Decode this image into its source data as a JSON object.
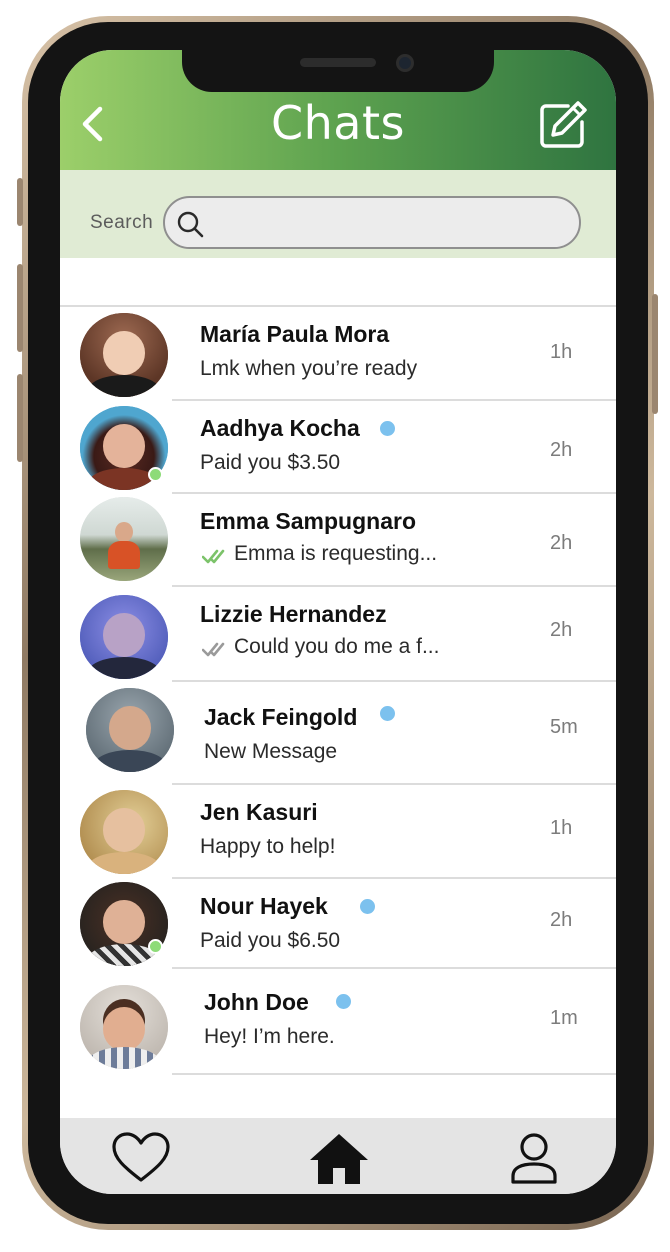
{
  "header": {
    "title": "Chats",
    "back_icon": "chevron-left-icon",
    "compose_icon": "compose-icon"
  },
  "search": {
    "label": "Search",
    "value": "",
    "icon": "search-icon"
  },
  "chats": [
    {
      "name": "María Paula Mora",
      "preview": "Lmk when you’re ready",
      "time": "1h",
      "unread": false,
      "online": false,
      "receipt": "none"
    },
    {
      "name": "Aadhya Kocha",
      "preview": "Paid you $3.50",
      "time": "2h",
      "unread": true,
      "online": true,
      "receipt": "none"
    },
    {
      "name": "Emma Sampugnaro",
      "preview": "Emma is requesting...",
      "time": "2h",
      "unread": false,
      "online": false,
      "receipt": "read"
    },
    {
      "name": "Lizzie Hernandez",
      "preview": "Could you do me a f...",
      "time": "2h",
      "unread": false,
      "online": false,
      "receipt": "delivered"
    },
    {
      "name": "Jack Feingold",
      "preview": "New Message",
      "time": "5m",
      "unread": true,
      "online": false,
      "receipt": "none"
    },
    {
      "name": "Jen Kasuri",
      "preview": "Happy to help!",
      "time": "1h",
      "unread": false,
      "online": false,
      "receipt": "none"
    },
    {
      "name": "Nour Hayek",
      "preview": "Paid you $6.50",
      "time": "2h",
      "unread": true,
      "online": true,
      "receipt": "none"
    },
    {
      "name": "John Doe",
      "preview": "Hey! I’m here.",
      "time": "1m",
      "unread": true,
      "online": false,
      "receipt": "none"
    }
  ],
  "bottom_nav": [
    {
      "icon": "heart-icon"
    },
    {
      "icon": "home-icon"
    },
    {
      "icon": "profile-icon"
    }
  ],
  "colors": {
    "header_start": "#9ccf6a",
    "header_end": "#2f7440",
    "search_band": "#e0ebd4",
    "unread": "#7cc1ee",
    "online": "#8ddb78",
    "read_check": "#7cc36a",
    "delivered_check": "#9a9a9a"
  }
}
